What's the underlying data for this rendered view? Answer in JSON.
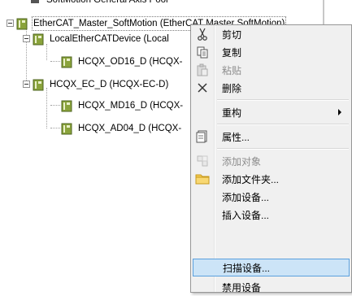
{
  "tree": {
    "partial_label": "SoftMotion General Axis Pool",
    "nodes": [
      {
        "label": "EtherCAT_Master_SoftMotion (EtherCAT Master SoftMotion)"
      },
      {
        "label": "LocalEtherCATDevice (Local"
      },
      {
        "label": "HCQX_OD16_D (HCQX-"
      },
      {
        "label": "HCQX_EC_D (HCQX-EC-D)"
      },
      {
        "label": "HCQX_MD16_D (HCQX-"
      },
      {
        "label": "HCQX_AD04_D (HCQX-"
      }
    ]
  },
  "context_menu": {
    "items": [
      {
        "label": "剪切",
        "icon": "scissors-icon",
        "enabled": true
      },
      {
        "label": "复制",
        "icon": "copy-icon",
        "enabled": true
      },
      {
        "label": "粘贴",
        "icon": "paste-icon",
        "enabled": false
      },
      {
        "label": "删除",
        "icon": "delete-icon",
        "enabled": true
      },
      {
        "label": "重构",
        "icon": "",
        "enabled": true,
        "submenu": true
      },
      {
        "label": "属性...",
        "icon": "properties-icon",
        "enabled": true
      },
      {
        "label": "添加对象",
        "icon": "add-object-icon",
        "enabled": false
      },
      {
        "label": "添加文件夹...",
        "icon": "folder-icon",
        "enabled": true
      },
      {
        "label": "添加设备...",
        "icon": "",
        "enabled": true
      },
      {
        "label": "插入设备...",
        "icon": "",
        "enabled": true
      },
      {
        "label": "扫描设备...",
        "icon": "",
        "enabled": true,
        "highlighted": true
      },
      {
        "label": "禁用设备",
        "icon": "",
        "enabled": true
      }
    ]
  },
  "colors": {
    "highlight_bg": "#cce4f7",
    "highlight_border": "#5aa0dd",
    "menu_bg": "#f0f0f0",
    "disabled_text": "#8d8d8d",
    "device_icon": "#6b8e23"
  }
}
